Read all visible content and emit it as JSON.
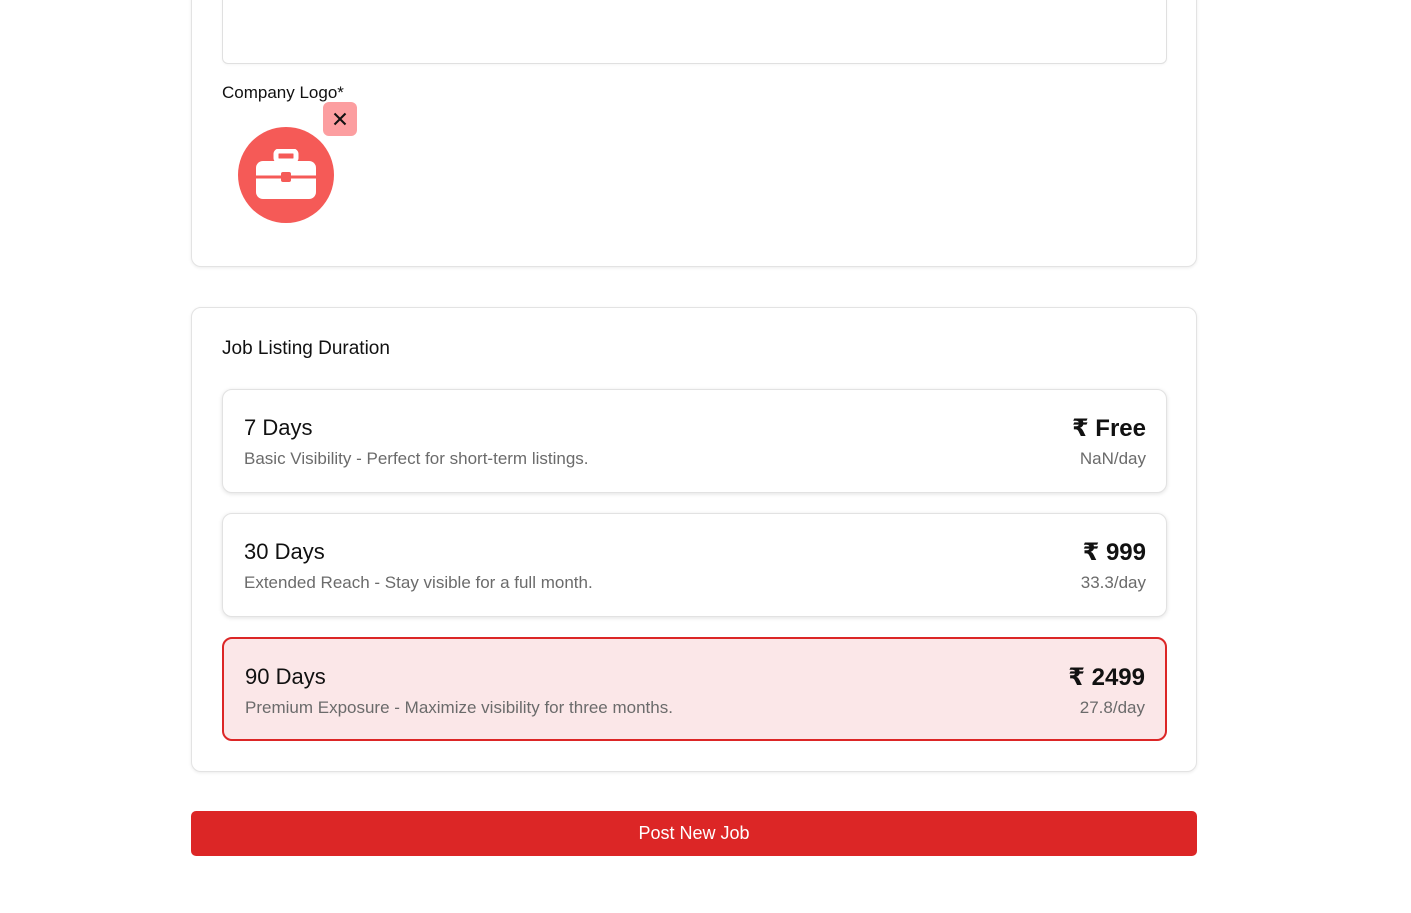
{
  "company_logo": {
    "label": "Company Logo*",
    "icon": "briefcase-icon",
    "remove_icon": "close-icon",
    "logo_color": "#f55a57"
  },
  "duration": {
    "title": "Job Listing Duration",
    "plans": [
      {
        "days": "7 Days",
        "description": "Basic Visibility - Perfect for short-term listings.",
        "price": "₹ Free",
        "per_day": "NaN/day",
        "selected": false
      },
      {
        "days": "30 Days",
        "description": "Extended Reach - Stay visible for a full month.",
        "price": "₹ 999",
        "per_day": "33.3/day",
        "selected": false
      },
      {
        "days": "90 Days",
        "description": "Premium Exposure - Maximize visibility for three months.",
        "price": "₹ 2499",
        "per_day": "27.8/day",
        "selected": true
      }
    ]
  },
  "submit": {
    "label": "Post New Job"
  },
  "colors": {
    "accent": "#dc2626",
    "selected_bg": "#fbe7e8"
  }
}
